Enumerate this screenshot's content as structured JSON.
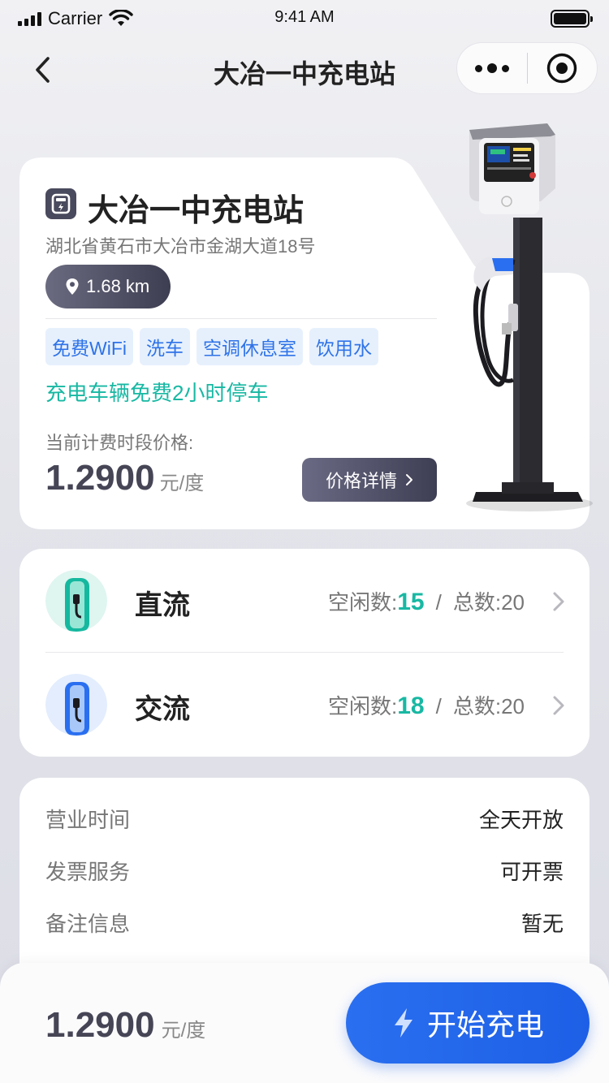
{
  "status_bar": {
    "carrier": "Carrier",
    "time": "9:41 AM"
  },
  "nav": {
    "title": "大冶一中充电站"
  },
  "station": {
    "name": "大冶一中充电站",
    "address": "湖北省黄石市大冶市金湖大道18号",
    "distance": "1.68 km",
    "tags": [
      "免费WiFi",
      "洗车",
      "空调休息室",
      "饮用水"
    ],
    "parking_note": "充电车辆免费2小时停车",
    "price_label": "当前计费时段价格:",
    "price": "1.2900",
    "price_unit": "元/度",
    "price_detail_label": "价格详情"
  },
  "charging_types": [
    {
      "name": "直流",
      "free_label": "空闲数:",
      "free": "15",
      "total_label": "总数:20",
      "color": "#18b8a3"
    },
    {
      "name": "交流",
      "free_label": "空闲数:",
      "free": "18",
      "total_label": "总数:20",
      "color": "#2a6ff0"
    }
  ],
  "info": [
    {
      "key": "营业时间",
      "value": "全天开放"
    },
    {
      "key": "发票服务",
      "value": "可开票"
    },
    {
      "key": "备注信息",
      "value": "暂无"
    }
  ],
  "bottom": {
    "price": "1.2900",
    "unit": "元/度",
    "start_label": "开始充电"
  },
  "colors": {
    "accent_teal": "#18b8a3",
    "accent_blue": "#2a6ff0",
    "dark": "#454556"
  }
}
